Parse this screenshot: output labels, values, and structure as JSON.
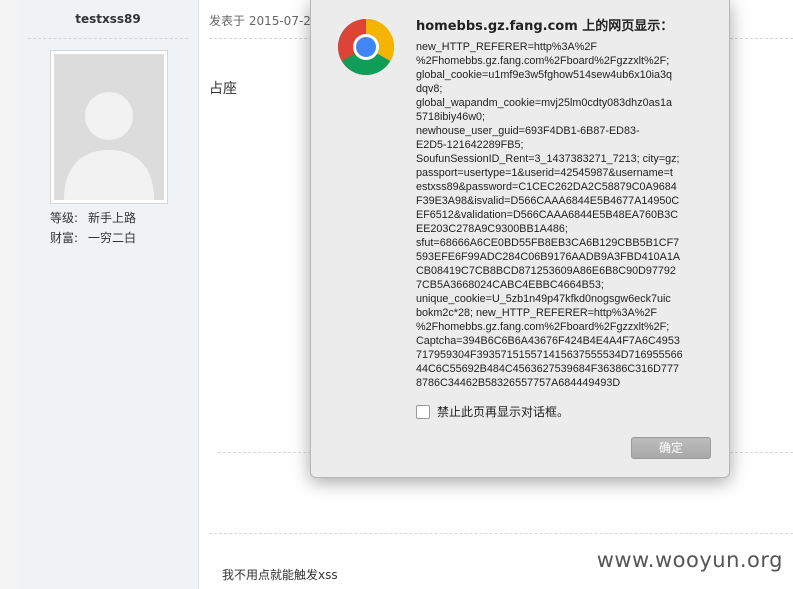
{
  "user": {
    "name": "testxss89",
    "level_label": "等级:",
    "level_value": "新手上路",
    "wealth_label": "财富:",
    "wealth_value": "一穷二白"
  },
  "post": {
    "time": "发表于 2015-07-20",
    "body": "占座",
    "signature": "我不用点就能触发xss"
  },
  "dialog": {
    "title": "homebbs.gz.fang.com 上的网页显示：",
    "message": "new_HTTP_REFERER=http%3A%2F\n%2Fhomebbs.gz.fang.com%2Fboard%2Fgzzxlt%2F;\nglobal_cookie=u1mf9e3w5fghow514sew4ub6x10ia3q\ndqv8;\nglobal_wapandm_cookie=mvj25lm0cdty083dhz0as1a\n5718ibiy46w0;\nnewhouse_user_guid=693F4DB1-6B87-ED83-\nE2D5-121642289FB5;\nSoufunSessionID_Rent=3_1437383271_7213; city=gz;\npassport=usertype=1&userid=42545987&username=t\nestxss89&password=C1CEC262DA2C58879C0A9684\nF39E3A98&isvalid=D566CAAA6844E5B4677A14950C\nEF6512&validation=D566CAAA6844E5B48EA760B3C\nEE203C278A9C9300BB1A486;\nsfut=68666A6CE0BD55FB8EB3CA6B129CBB5B1CF7\n593EFE6F99ADC284C06B9176AADB9A3FBD410A1A\nCB08419C7CB8BCD871253609A86E6B8C90D97792\n7CB5A3668024CABC4EBBC4664B53;\nunique_cookie=U_5zb1n49p47kfkd0nogsgw6eck7uic\nbokm2c*28; new_HTTP_REFERER=http%3A%2F\n%2Fhomebbs.gz.fang.com%2Fboard%2Fgzzxlt%2F;\nCaptcha=394B6C6B6A43676F424B4E4A4F7A6C4953\n717959304F393571515571415637555534D716955566\n44C6C55692B484C4563627539684F36386C316D777\n8786C34462B58326557757A684449493D",
    "checkbox_label": "禁止此页再显示对话框。",
    "checkbox_checked": false,
    "ok_label": "确定"
  },
  "watermark": "www.wooyun.org",
  "icons": {
    "browser": "chrome-logo-icon",
    "avatar": "default-avatar-icon"
  }
}
